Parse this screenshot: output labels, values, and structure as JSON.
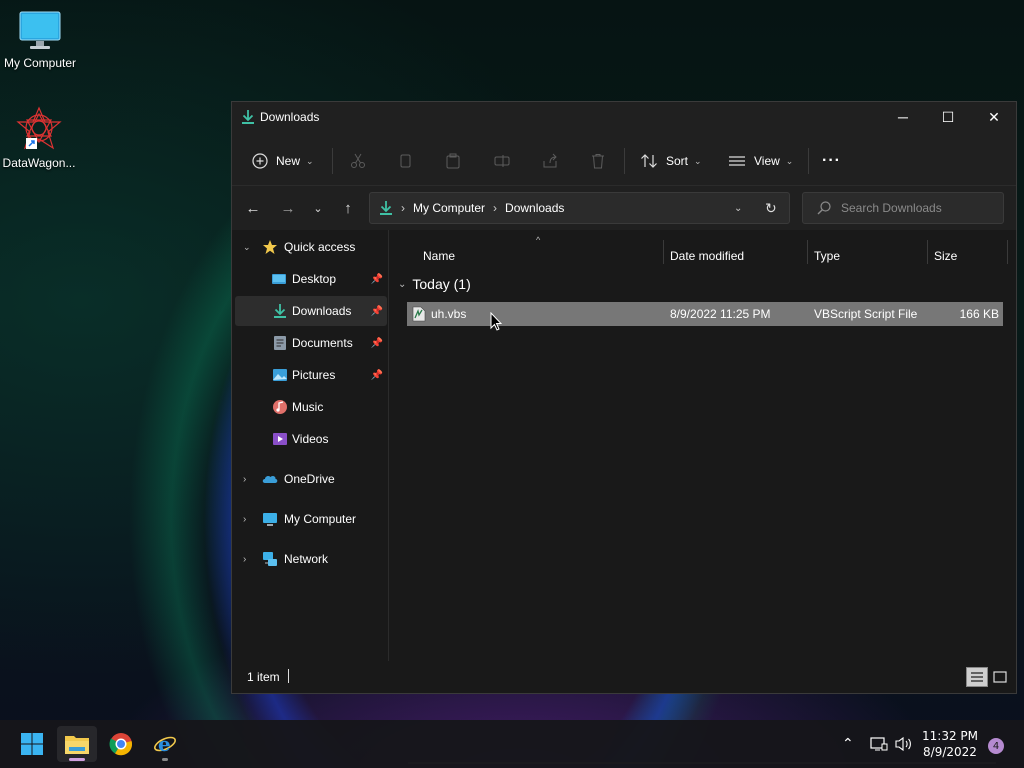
{
  "desktop": {
    "icons": [
      {
        "label": "My Computer",
        "icon": "monitor-icon"
      },
      {
        "label": "DataWagon...",
        "icon": "datawagon-shortcut-icon"
      }
    ]
  },
  "window": {
    "title": "Downloads",
    "controls": {
      "minimize": "─",
      "maximize": "☐",
      "close": "✕"
    },
    "toolbar": {
      "new_label": "New",
      "sort_label": "Sort",
      "view_label": "View",
      "more": "···"
    },
    "address": {
      "crumbs": [
        "My Computer",
        "Downloads"
      ],
      "separator": "›"
    },
    "search": {
      "placeholder": "Search Downloads"
    },
    "nav": {
      "quick_access": "Quick access",
      "items": [
        {
          "label": "Desktop",
          "pinned": true
        },
        {
          "label": "Downloads",
          "pinned": true,
          "selected": true
        },
        {
          "label": "Documents",
          "pinned": true
        },
        {
          "label": "Pictures",
          "pinned": true
        },
        {
          "label": "Music",
          "pinned": false
        },
        {
          "label": "Videos",
          "pinned": false
        }
      ],
      "roots": [
        "OneDrive",
        "My Computer",
        "Network"
      ]
    },
    "columns": [
      "Name",
      "Date modified",
      "Type",
      "Size"
    ],
    "group": {
      "label": "Today (1)"
    },
    "files": [
      {
        "name": "uh.vbs",
        "date": "8/9/2022 11:25 PM",
        "type": "VBScript Script File",
        "size": "166 KB"
      }
    ],
    "status": {
      "count": "1 item"
    }
  },
  "taskbar": {
    "apps": [
      "start-button",
      "file-explorer",
      "chrome",
      "internet-explorer"
    ],
    "clock": {
      "time": "11:32 PM",
      "date": "8/9/2022"
    },
    "notifications": "4"
  },
  "colors": {
    "window_bg": "#191919",
    "chrome_bg": "#202020",
    "selected_row": "#777777",
    "downloads_accent": "#3fc1a5",
    "folder_yellow": "#f2c94c"
  }
}
